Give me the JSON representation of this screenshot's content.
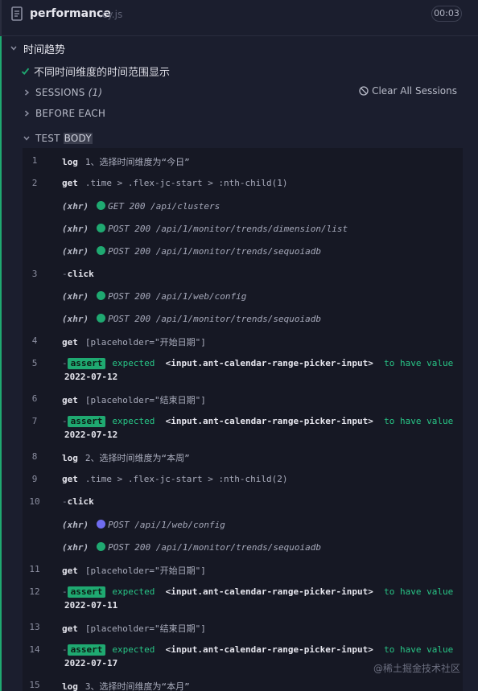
{
  "header": {
    "spec_name": "performance",
    "spec_ext": ".cy.js",
    "duration": "00:03"
  },
  "suite": {
    "title": "时间趋势"
  },
  "test": {
    "title": "不同时间维度的时间范围显示"
  },
  "sections": {
    "sessions_label": "SESSIONS",
    "sessions_count": "(1)",
    "clear_sessions": "Clear All Sessions",
    "before_each": "BEFORE EACH",
    "test_body_prefix": "TEST",
    "test_body_highlight": "BODY"
  },
  "colors": {
    "pass_green": "#1fa971",
    "pending_purple": "#6f6cf0",
    "background": "#1b1e2e"
  },
  "commands": [
    {
      "num": "1",
      "type": "log",
      "cmd": "log",
      "text": "1、选择时间维度为“今日”"
    },
    {
      "num": "2",
      "type": "get",
      "cmd": "get",
      "text": ".time > .flex-jc-start > :nth-child(1)"
    },
    {
      "num": "",
      "type": "xhr",
      "label": "(xhr)",
      "status": "green",
      "text": "GET 200 /api/clusters"
    },
    {
      "num": "",
      "type": "xhr",
      "label": "(xhr)",
      "status": "green",
      "text": "POST 200 /api/1/monitor/trends/dimension/list"
    },
    {
      "num": "",
      "type": "xhr",
      "label": "(xhr)",
      "status": "green",
      "text": "POST 200 /api/1/monitor/trends/sequoiadb"
    },
    {
      "num": "3",
      "type": "child",
      "cmd": "click",
      "text": ""
    },
    {
      "num": "",
      "type": "xhr",
      "label": "(xhr)",
      "status": "green",
      "text": "POST 200 /api/1/web/config"
    },
    {
      "num": "",
      "type": "xhr",
      "label": "(xhr)",
      "status": "green",
      "text": "POST 200 /api/1/monitor/trends/sequoiadb"
    },
    {
      "num": "4",
      "type": "get",
      "cmd": "get",
      "text": "[placeholder=\"开始日期\"]"
    },
    {
      "num": "5",
      "type": "assert",
      "badge": "assert",
      "expected": "expected",
      "subject": "<input.ant-calendar-range-picker-input>",
      "verb": "to have value",
      "value": "2022-07-12"
    },
    {
      "num": "6",
      "type": "get",
      "cmd": "get",
      "text": "[placeholder=\"结束日期\"]"
    },
    {
      "num": "7",
      "type": "assert",
      "badge": "assert",
      "expected": "expected",
      "subject": "<input.ant-calendar-range-picker-input>",
      "verb": "to have value",
      "value": "2022-07-12"
    },
    {
      "num": "8",
      "type": "log",
      "cmd": "log",
      "text": "2、选择时间维度为“本周”"
    },
    {
      "num": "9",
      "type": "get",
      "cmd": "get",
      "text": ".time > .flex-jc-start > :nth-child(2)"
    },
    {
      "num": "10",
      "type": "child",
      "cmd": "click",
      "text": ""
    },
    {
      "num": "",
      "type": "xhr",
      "label": "(xhr)",
      "status": "purple",
      "text": "POST /api/1/web/config"
    },
    {
      "num": "",
      "type": "xhr",
      "label": "(xhr)",
      "status": "green",
      "text": "POST 200 /api/1/monitor/trends/sequoiadb"
    },
    {
      "num": "11",
      "type": "get",
      "cmd": "get",
      "text": "[placeholder=\"开始日期\"]"
    },
    {
      "num": "12",
      "type": "assert",
      "badge": "assert",
      "expected": "expected",
      "subject": "<input.ant-calendar-range-picker-input>",
      "verb": "to have value",
      "value": "2022-07-11"
    },
    {
      "num": "13",
      "type": "get",
      "cmd": "get",
      "text": "[placeholder=\"结束日期\"]"
    },
    {
      "num": "14",
      "type": "assert",
      "badge": "assert",
      "expected": "expected",
      "subject": "<input.ant-calendar-range-picker-input>",
      "verb": "to have value",
      "value": "2022-07-17"
    },
    {
      "num": "15",
      "type": "log",
      "cmd": "log",
      "text": "3、选择时间维度为“本月”"
    }
  ],
  "watermark": "@稀土掘金技术社区"
}
